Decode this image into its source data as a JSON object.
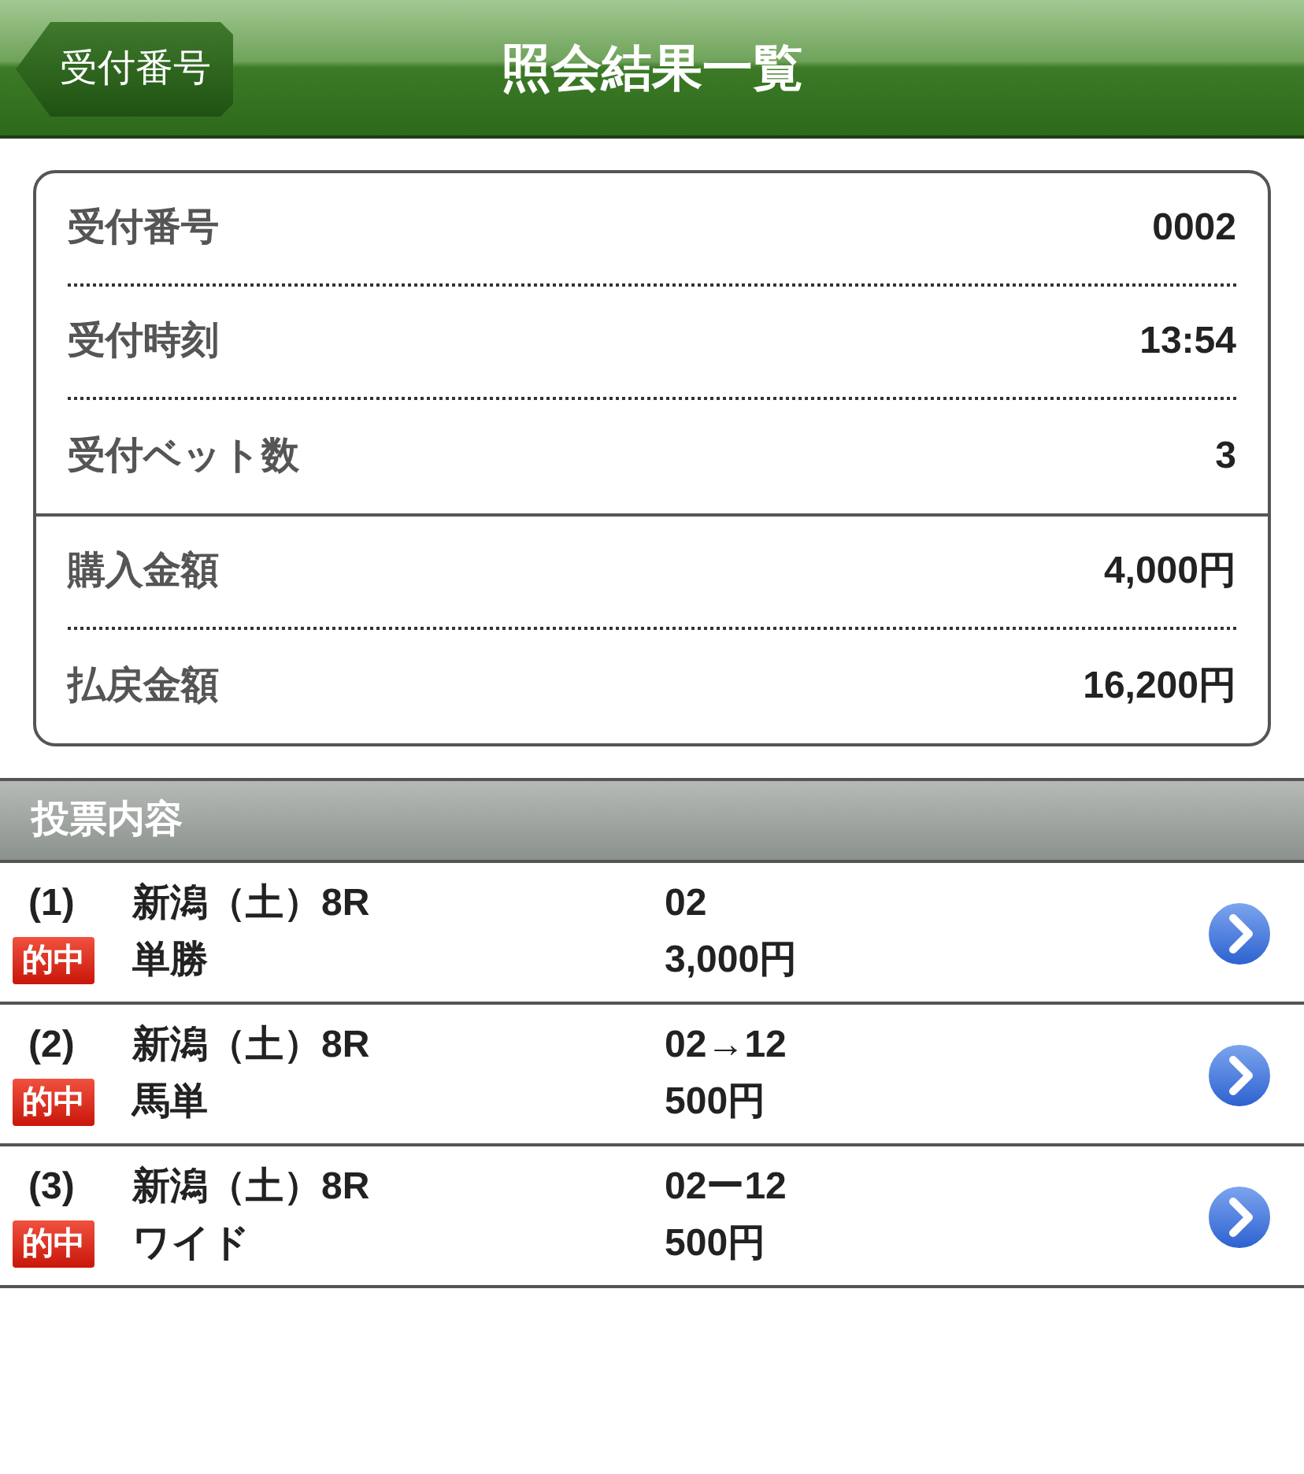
{
  "header": {
    "back_button": "受付番号",
    "title": "照会結果一覧"
  },
  "summary": {
    "groups": [
      {
        "rows": [
          {
            "label": "受付番号",
            "value": "0002"
          },
          {
            "label": "受付時刻",
            "value": "13:54"
          },
          {
            "label": "受付ベット数",
            "value": "3"
          }
        ]
      },
      {
        "rows": [
          {
            "label": "購入金額",
            "value": "4,000円"
          },
          {
            "label": "払戻金額",
            "value": "16,200円"
          }
        ]
      }
    ]
  },
  "section": {
    "title": "投票内容"
  },
  "bets": [
    {
      "number": "(1)",
      "race": "新潟（土）8R",
      "selection": "02",
      "badge": "的中",
      "bet_type": "単勝",
      "amount": "3,000円"
    },
    {
      "number": "(2)",
      "race": "新潟（土）8R",
      "selection": "02→12",
      "badge": "的中",
      "bet_type": "馬単",
      "amount": "500円"
    },
    {
      "number": "(3)",
      "race": "新潟（土）8R",
      "selection": "02ー12",
      "badge": "的中",
      "bet_type": "ワイド",
      "amount": "500円"
    }
  ]
}
